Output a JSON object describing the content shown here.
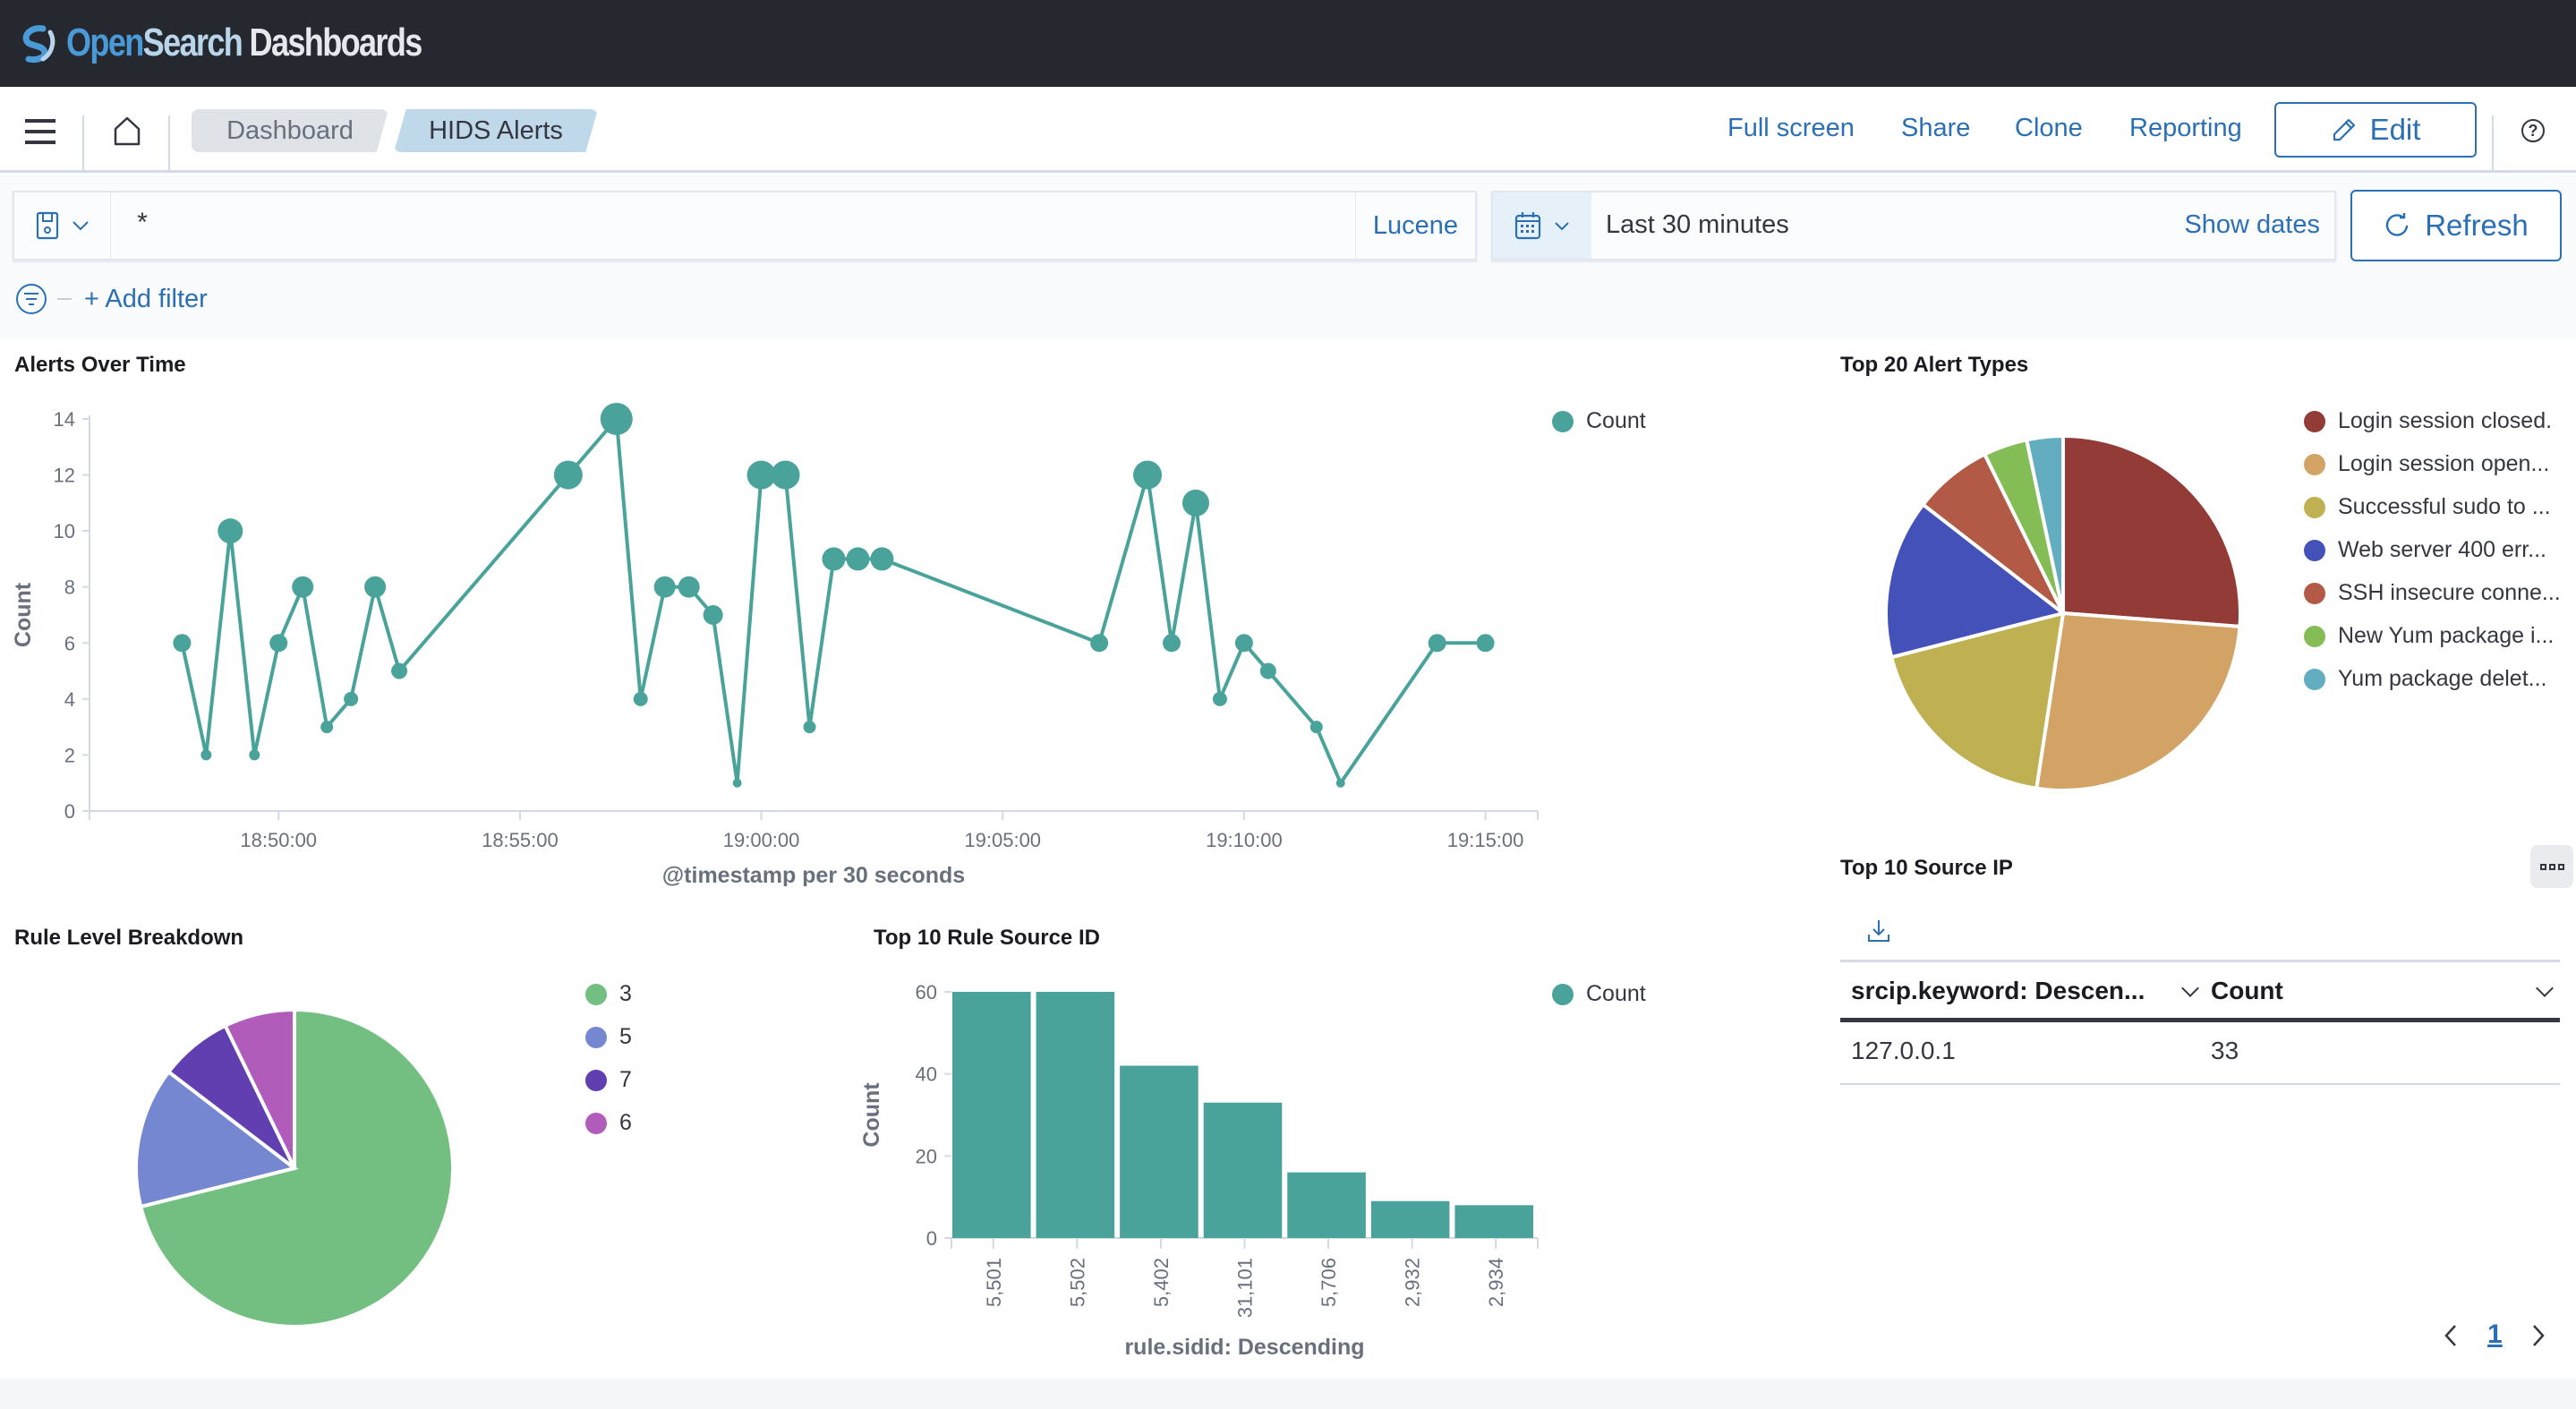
{
  "app": {
    "logo_open": "Open",
    "logo_search": "Search",
    "logo_dashboards": " Dashboards"
  },
  "nav": {
    "menu_icon": "hamburger-icon",
    "home_icon": "home-icon",
    "breadcrumbs": [
      "Dashboard",
      "HIDS Alerts"
    ],
    "links": [
      "Full screen",
      "Share",
      "Clone",
      "Reporting"
    ],
    "edit_label": "Edit",
    "help_label": "?"
  },
  "query": {
    "value": "*",
    "language": "Lucene"
  },
  "time": {
    "range_label": "Last 30 minutes",
    "show_dates": "Show dates",
    "refresh_label": "Refresh"
  },
  "filters": {
    "add_filter": "+ Add filter"
  },
  "colors": {
    "accent": "#2b70b5",
    "series": "#4aa39a",
    "header_bg": "#25282f"
  },
  "chart_data": [
    {
      "id": "alerts-over-time",
      "type": "line",
      "title": "Alerts Over Time",
      "xlabel": "@timestamp per 30 seconds",
      "ylabel": "Count",
      "legend": [
        "Count"
      ],
      "legend_position": "top-right",
      "x_ticks": [
        "18:50:00",
        "18:55:00",
        "19:00:00",
        "19:05:00",
        "19:10:00",
        "19:15:00"
      ],
      "x_domain": [
        "18:46:05",
        "19:16:05"
      ],
      "ylim": [
        0,
        14
      ],
      "y_ticks": [
        0,
        2,
        4,
        6,
        8,
        10,
        12,
        14
      ],
      "x": [
        "18:48:00",
        "18:48:30",
        "18:49:00",
        "18:49:30",
        "18:50:00",
        "18:50:30",
        "18:51:00",
        "18:51:30",
        "18:52:00",
        "18:52:30",
        "18:56:00",
        "18:57:00",
        "18:57:30",
        "18:58:00",
        "18:58:30",
        "18:59:00",
        "18:59:30",
        "19:00:00",
        "19:00:30",
        "19:01:00",
        "19:01:30",
        "19:02:00",
        "19:02:30",
        "19:07:00",
        "19:08:00",
        "19:08:30",
        "19:09:00",
        "19:09:30",
        "19:10:00",
        "19:10:30",
        "19:11:30",
        "19:12:00",
        "19:14:00",
        "19:15:00"
      ],
      "values": [
        6,
        2,
        10,
        2,
        6,
        8,
        3,
        4,
        8,
        5,
        12,
        14,
        4,
        8,
        8,
        7,
        1,
        12,
        12,
        3,
        9,
        9,
        9,
        6,
        12,
        6,
        11,
        4,
        6,
        5,
        3,
        1,
        6,
        6
      ]
    },
    {
      "id": "top-20-alert-types",
      "type": "pie",
      "title": "Top 20 Alert Types",
      "legend_position": "right",
      "categories": [
        "Login session closed.",
        "Login session open...",
        "Successful sudo to ...",
        "Web server 400 err...",
        "SSH insecure conne...",
        "New Yum package i...",
        "Yum package delet..."
      ],
      "values": [
        26.2,
        26.2,
        18.6,
        14.5,
        7.2,
        4.0,
        3.3
      ],
      "colors": [
        "#923b37",
        "#d3a265",
        "#bfb052",
        "#4351b8",
        "#b35a46",
        "#84bd55",
        "#62adc0"
      ]
    },
    {
      "id": "rule-level-breakdown",
      "type": "pie",
      "title": "Rule Level Breakdown",
      "legend_position": "right",
      "categories": [
        "3",
        "5",
        "7",
        "6"
      ],
      "values": [
        71.1,
        14.3,
        7.4,
        7.2
      ],
      "colors": [
        "#73bf82",
        "#7587d0",
        "#623fb0",
        "#b15bbb"
      ]
    },
    {
      "id": "top-10-rule-source-id",
      "type": "bar",
      "title": "Top 10 Rule Source ID",
      "xlabel": "rule.sidid: Descending",
      "ylabel": "Count",
      "legend": [
        "Count"
      ],
      "legend_position": "top-right",
      "categories": [
        "5,501",
        "5,502",
        "5,402",
        "31,101",
        "5,706",
        "2,932",
        "2,934"
      ],
      "values": [
        60,
        60,
        42,
        33,
        16,
        9,
        8
      ],
      "ylim": [
        0,
        60
      ],
      "y_ticks": [
        0,
        20,
        40,
        60
      ]
    }
  ],
  "source_ip_table": {
    "title": "Top 10 Source IP",
    "columns": [
      "srcip.keyword: Descen...",
      "Count"
    ],
    "rows": [
      [
        "127.0.0.1",
        "33"
      ]
    ],
    "page": "1"
  }
}
